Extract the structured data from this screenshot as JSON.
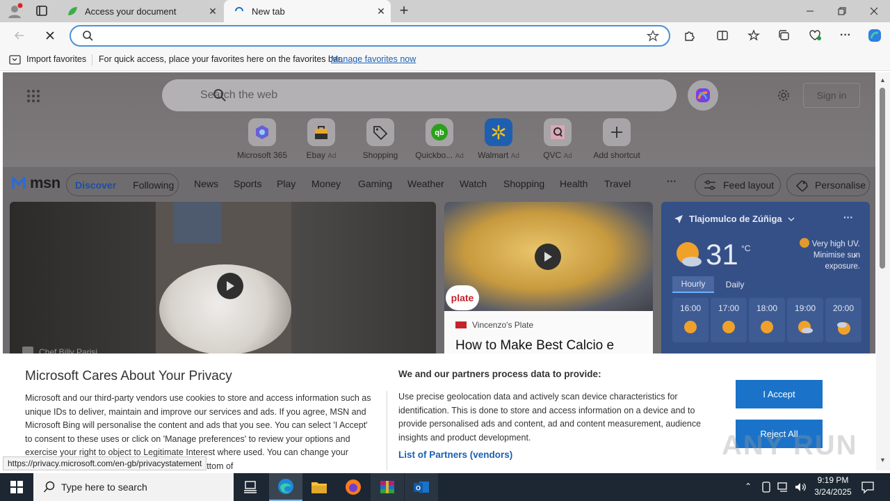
{
  "browser": {
    "tabs": [
      {
        "title": "Access your document",
        "active": false
      },
      {
        "title": "New tab",
        "active": true
      }
    ],
    "address_bar": {
      "value": ""
    },
    "favorites_bar": {
      "import_label": "Import favorites",
      "hint": "For quick access, place your favorites here on the favorites bar.",
      "manage_link": "Manage favorites now"
    },
    "status_url": "https://privacy.microsoft.com/en-gb/privacystatement"
  },
  "newtab": {
    "search_placeholder": "Search the web",
    "sign_in": "Sign in",
    "shortcuts": [
      {
        "label": "Microsoft 365",
        "ad": ""
      },
      {
        "label": "Ebay",
        "ad": "Ad"
      },
      {
        "label": "Shopping",
        "ad": ""
      },
      {
        "label": "Quickbo...",
        "ad": "Ad"
      },
      {
        "label": "Walmart",
        "ad": "Ad"
      },
      {
        "label": "QVC",
        "ad": "Ad"
      },
      {
        "label": "Add shortcut",
        "ad": ""
      }
    ],
    "msn": {
      "logo": "msn",
      "tabs": [
        "Discover",
        "Following"
      ],
      "nav": [
        "News",
        "Sports",
        "Play",
        "Money",
        "Gaming",
        "Weather",
        "Watch",
        "Shopping",
        "Health",
        "Travel"
      ],
      "more": "···",
      "feed_layout": "Feed layout",
      "personalise": "Personalise"
    },
    "cards": {
      "main_source": "Chef Billy Parisi",
      "side_source": "Vincenzo's Plate",
      "side_title": "How to Make Best Calcio e",
      "side_logo": "plate"
    },
    "weather": {
      "location": "Tlajomulco de Zúñiga",
      "temp": "31",
      "unit": "°C",
      "alert": "Very high UV. Minimise sun exposure.",
      "tabs": [
        "Hourly",
        "Daily"
      ],
      "hours": [
        "16:00",
        "17:00",
        "18:00",
        "19:00",
        "20:00"
      ]
    }
  },
  "consent": {
    "title": "Microsoft Cares About Your Privacy",
    "body": "Microsoft and our third-party vendors use cookies to store and access information such as unique IDs to deliver, maintain and improve our services and ads. If you agree, MSN and Microsoft Bing will personalise the content and ads that you see. You can select 'I Accept' to consent to these uses or click on 'Manage preferences' to review your options and exercise your right to object to Legitimate Interest where used. You can change your selection under 'Manage Preferences' at the bottom of",
    "right_title": "We and our partners process data to provide:",
    "right_body": "Use precise geolocation data and actively scan device characteristics for identification. This is done to store and access information on a device and to provide personalised ads and content, ad and content measurement, audience insights and product development.",
    "partners_link": "List of Partners (vendors)",
    "accept": "I Accept",
    "reject": "Reject All"
  },
  "watermark": "ANY RUN",
  "taskbar": {
    "search_placeholder": "Type here to search",
    "time": "9:19 PM",
    "date": "3/24/2025"
  }
}
